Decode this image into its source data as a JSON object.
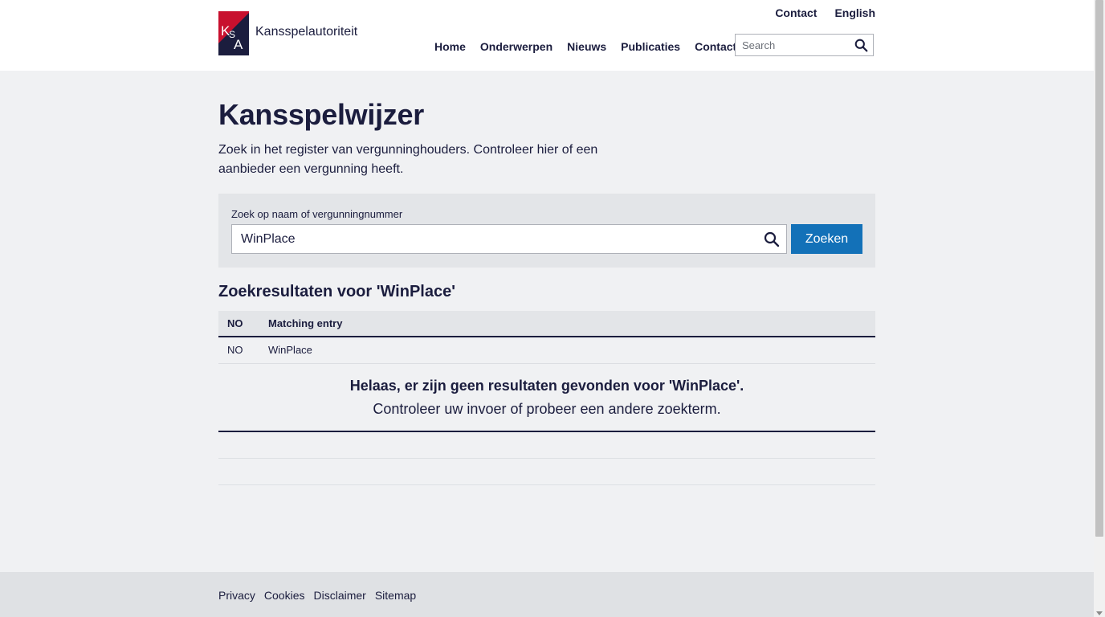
{
  "header": {
    "logo_text": "Kansspelautoriteit",
    "utility_nav": [
      "Contact",
      "English"
    ],
    "main_nav": [
      "Home",
      "Onderwerpen",
      "Nieuws",
      "Publicaties",
      "Contact"
    ],
    "search_placeholder": "Search"
  },
  "main": {
    "title": "Kansspelwijzer",
    "intro": "Zoek in het register van vergunninghouders. Controleer hier of een aanbieder een vergunning heeft.",
    "search": {
      "label": "Zoek op naam of vergunningnummer",
      "value": "WinPlace",
      "submit_label": "Zoeken"
    },
    "results": {
      "heading": "Zoekresultaten voor 'WinPlace'",
      "columns": [
        "NO",
        "Matching entry"
      ],
      "rows": [
        [
          "NO",
          "WinPlace"
        ]
      ],
      "no_results_title": "Helaas, er zijn geen resultaten gevonden voor 'WinPlace'.",
      "no_results_hint": "Controleer uw invoer of probeer een andere zoekterm."
    }
  },
  "footer": {
    "links": [
      "Privacy",
      "Cookies",
      "Disclaimer",
      "Sitemap"
    ]
  },
  "colors": {
    "brand_navy": "#1b1d3e",
    "brand_red": "#c8102e",
    "accent_blue": "#1371b8",
    "page_bg": "#f0f1f3"
  },
  "icons": {
    "header_search": "search-icon",
    "main_search": "search-icon"
  }
}
